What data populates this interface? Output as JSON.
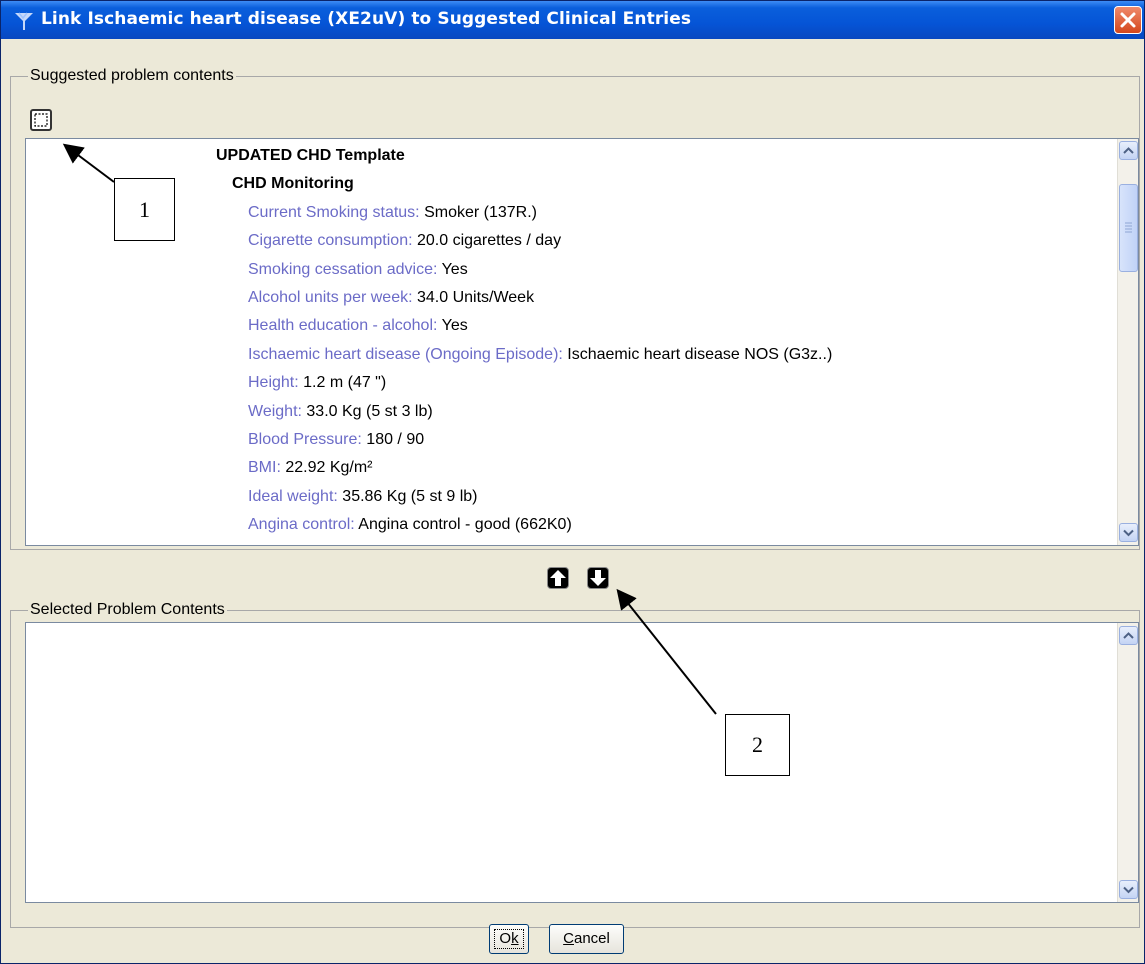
{
  "window": {
    "title": "Link Ischaemic heart disease (XE2uV) to Suggested Clinical Entries"
  },
  "suggested": {
    "legend": "Suggested problem contents",
    "template_title": "UPDATED CHD Template",
    "section_title": "CHD Monitoring",
    "items": [
      {
        "label": "Current Smoking status:",
        "value": " Smoker (137R.)"
      },
      {
        "label": "Cigarette consumption:",
        "value": "  20.0 cigarettes / day"
      },
      {
        "label": "Smoking cessation advice:",
        "value": " Yes"
      },
      {
        "label": "Alcohol units per week:",
        "value": "  34.0 Units/Week"
      },
      {
        "label": "Health education - alcohol:",
        "value": " Yes"
      },
      {
        "label": "Ischaemic heart disease (Ongoing Episode):",
        "value": " Ischaemic heart disease NOS (G3z..)"
      },
      {
        "label": "Height:",
        "value": "  1.2 m  (47 \")"
      },
      {
        "label": "Weight:",
        "value": "  33.0 Kg  (5 st 3 lb)"
      },
      {
        "label": "Blood Pressure:",
        "value": " 180 / 90"
      },
      {
        "label": "BMI:",
        "value": "  22.92 Kg/m²"
      },
      {
        "label": "Ideal weight:",
        "value": "  35.86 Kg  (5 st 9 lb)"
      },
      {
        "label": "Angina control:",
        "value": " Angina control - good (662K0)"
      }
    ]
  },
  "selected": {
    "legend": "Selected Problem Contents"
  },
  "callouts": {
    "one": "1",
    "two": "2"
  },
  "buttons": {
    "ok": "Ok",
    "cancel": "Cancel"
  },
  "colors": {
    "title_bar": "#0554d6",
    "label_text": "#6b6bc7",
    "close_button": "#d4471c"
  }
}
